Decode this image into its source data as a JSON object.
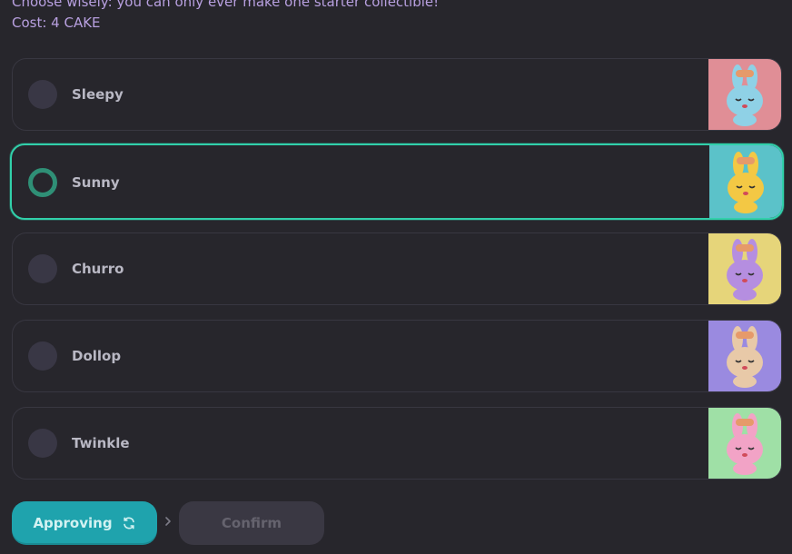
{
  "intro": {
    "warning": "Choose wisely: you can only ever make one starter collectible!",
    "cost": "Cost: 4 CAKE"
  },
  "options": [
    {
      "label": "Sleepy",
      "selected": false,
      "thumb_bg": "#e08e96",
      "bunny_color": "#8fd1e6",
      "icon": "sleepy-bunny-icon"
    },
    {
      "label": "Sunny",
      "selected": true,
      "thumb_bg": "#5bc2c9",
      "bunny_color": "#f3c844",
      "icon": "sunny-bunny-icon"
    },
    {
      "label": "Churro",
      "selected": false,
      "thumb_bg": "#e6d57a",
      "bunny_color": "#b58ee0",
      "icon": "churro-bunny-icon"
    },
    {
      "label": "Dollop",
      "selected": false,
      "thumb_bg": "#9a8ae0",
      "bunny_color": "#e8c9a8",
      "icon": "dollop-bunny-icon"
    },
    {
      "label": "Twinkle",
      "selected": false,
      "thumb_bg": "#9fe0a6",
      "bunny_color": "#f2a3c6",
      "icon": "twinkle-bunny-icon"
    }
  ],
  "actions": {
    "approving_label": "Approving",
    "confirm_label": "Confirm"
  },
  "colors": {
    "accent": "#31d0aa",
    "primary": "#1fa3ad",
    "text_secondary": "#b8a0e0"
  }
}
